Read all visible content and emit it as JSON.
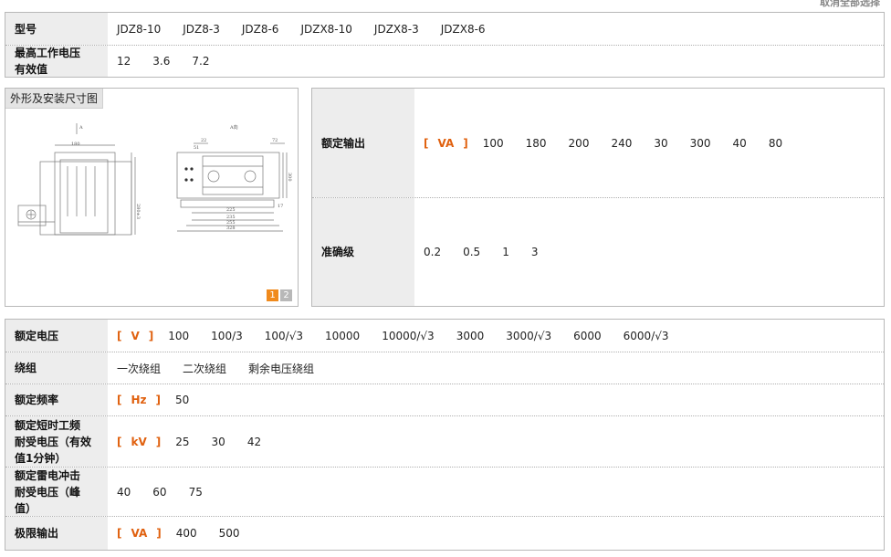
{
  "top_link": "取消全部选择",
  "models": {
    "label": "型号",
    "values": [
      "JDZ8-10",
      "JDZ8-3",
      "JDZ8-6",
      "JDZX8-10",
      "JDZX8-3",
      "JDZX8-6"
    ]
  },
  "max_voltage": {
    "label_line1": "最高工作电压",
    "label_line2": "有效值",
    "values": [
      "12",
      "3.6",
      "7.2"
    ]
  },
  "drawing": {
    "title": "外形及安装尺寸图",
    "pages": [
      "1",
      "2"
    ]
  },
  "rated_output": {
    "label": "额定输出",
    "unit": "VA",
    "values": [
      "100",
      "180",
      "200",
      "240",
      "30",
      "300",
      "40",
      "80"
    ]
  },
  "accuracy": {
    "label": "准确级",
    "values": [
      "0.2",
      "0.5",
      "1",
      "3"
    ]
  },
  "rated_voltage": {
    "label": "额定电压",
    "unit": "V",
    "values": [
      "100",
      "100/3",
      "100/√3",
      "10000",
      "10000/√3",
      "3000",
      "3000/√3",
      "6000",
      "6000/√3"
    ]
  },
  "winding": {
    "label": "绕组",
    "values": [
      "一次绕组",
      "二次绕组",
      "剩余电压绕组"
    ]
  },
  "frequency": {
    "label": "额定频率",
    "unit": "Hz",
    "values": [
      "50"
    ]
  },
  "short_withstand": {
    "label_line1": "额定短时工频",
    "label_line2": "耐受电压（有效",
    "label_line3": "值1分钟）",
    "unit": "kV",
    "values": [
      "25",
      "30",
      "42"
    ]
  },
  "impulse_withstand": {
    "label_line1": "额定雷电冲击",
    "label_line2": "耐受电压（峰",
    "label_line3": "值）",
    "values": [
      "40",
      "60",
      "75"
    ]
  },
  "limit_output": {
    "label": "极限输出",
    "unit": "VA",
    "values": [
      "400",
      "500"
    ]
  },
  "dims": {
    "d180": "180",
    "d280": "280±3",
    "d225": "225",
    "d235": "235",
    "d255": "255",
    "d328": "328",
    "d300": "300",
    "d17": "17",
    "d22": "22",
    "d51": "51",
    "d72": "72",
    "arrowA": "A",
    "viewA": "A向"
  },
  "colors": {
    "accent": "#e0600e",
    "label_bg": "#ededed",
    "pager_on": "#f08a1c"
  }
}
